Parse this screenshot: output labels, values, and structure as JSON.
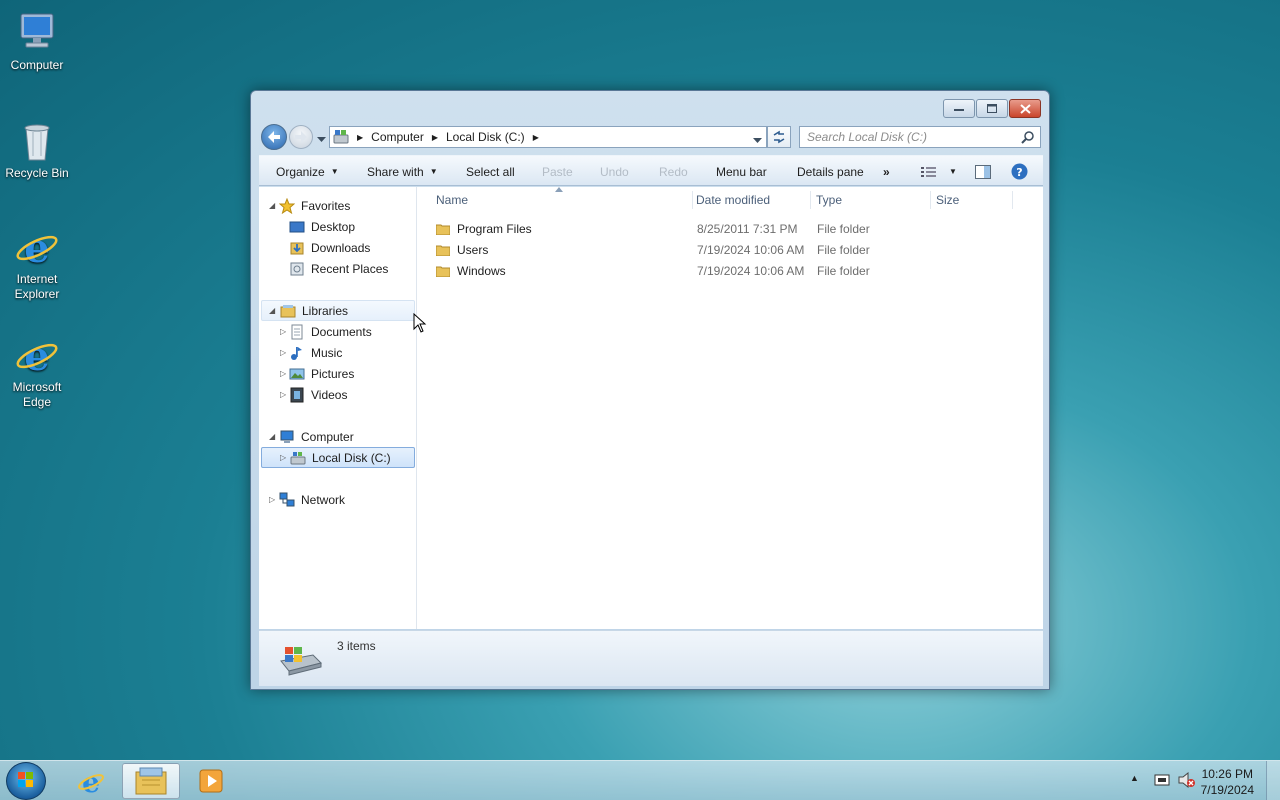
{
  "desktop": {
    "icons": [
      {
        "label": "Computer"
      },
      {
        "label": "Recycle Bin"
      },
      {
        "label": "Internet Explorer"
      },
      {
        "label": "Microsoft Edge"
      }
    ]
  },
  "window": {
    "address": {
      "crumbs": [
        "Computer",
        "Local Disk (C:)"
      ]
    },
    "search": {
      "placeholder": "Search Local Disk (C:)"
    },
    "toolbar": {
      "organize": "Organize",
      "share_with": "Share with",
      "select_all": "Select all",
      "paste": "Paste",
      "undo": "Undo",
      "redo": "Redo",
      "menu_bar": "Menu bar",
      "details_pane": "Details pane",
      "more": "»"
    },
    "nav_pane": {
      "favorites": {
        "label": "Favorites",
        "items": [
          "Desktop",
          "Downloads",
          "Recent Places"
        ]
      },
      "libraries": {
        "label": "Libraries",
        "items": [
          "Documents",
          "Music",
          "Pictures",
          "Videos"
        ]
      },
      "computer": {
        "label": "Computer",
        "items": [
          "Local Disk (C:)"
        ]
      },
      "network": {
        "label": "Network"
      }
    },
    "columns": [
      "Name",
      "Date modified",
      "Type",
      "Size"
    ],
    "files": [
      {
        "name": "Program Files",
        "date": "8/25/2011 7:31 PM",
        "type": "File folder",
        "size": ""
      },
      {
        "name": "Users",
        "date": "7/19/2024 10:06 AM",
        "type": "File folder",
        "size": ""
      },
      {
        "name": "Windows",
        "date": "7/19/2024 10:06 AM",
        "type": "File folder",
        "size": ""
      }
    ],
    "details": {
      "count_text": "3 items"
    }
  },
  "taskbar": {
    "clock": {
      "time": "10:26 PM",
      "date": "7/19/2024"
    }
  },
  "colors": {
    "accent": "#2b66ad",
    "desktop": "#1b7f93",
    "close": "#c9452c"
  }
}
